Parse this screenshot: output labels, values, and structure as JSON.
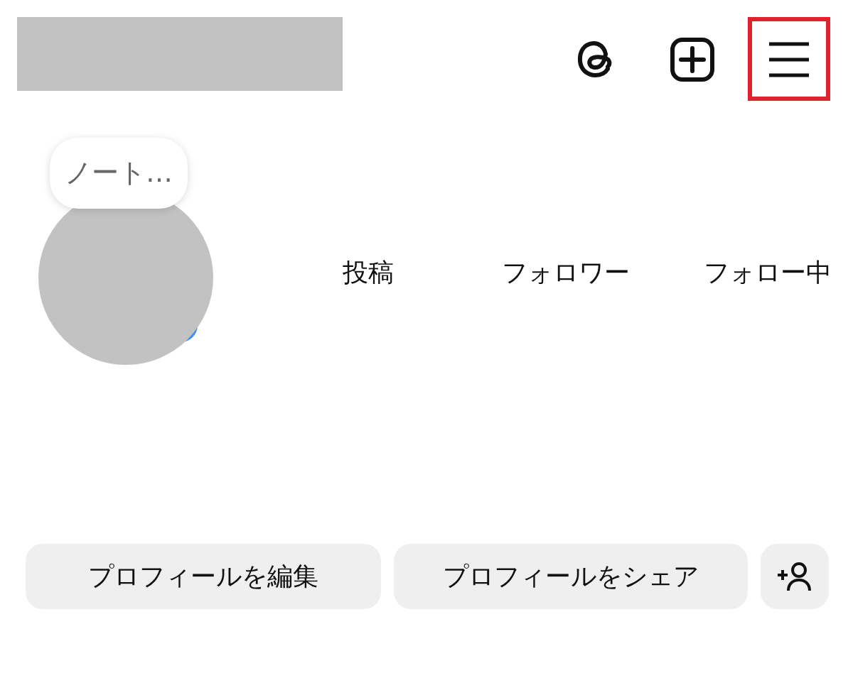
{
  "header": {
    "icons": [
      {
        "kind": "threads",
        "highlighted": false
      },
      {
        "kind": "new-post",
        "highlighted": false
      },
      {
        "kind": "menu",
        "highlighted": true
      }
    ]
  },
  "note": {
    "text": "ノート…"
  },
  "stats": [
    {
      "label": "投稿"
    },
    {
      "label": "フォロワー"
    },
    {
      "label": "フォロー中"
    }
  ],
  "buttons": [
    {
      "kind": "text",
      "label": "プロフィールを編集"
    },
    {
      "kind": "text",
      "label": "プロフィールをシェア"
    },
    {
      "kind": "add-person"
    }
  ]
}
